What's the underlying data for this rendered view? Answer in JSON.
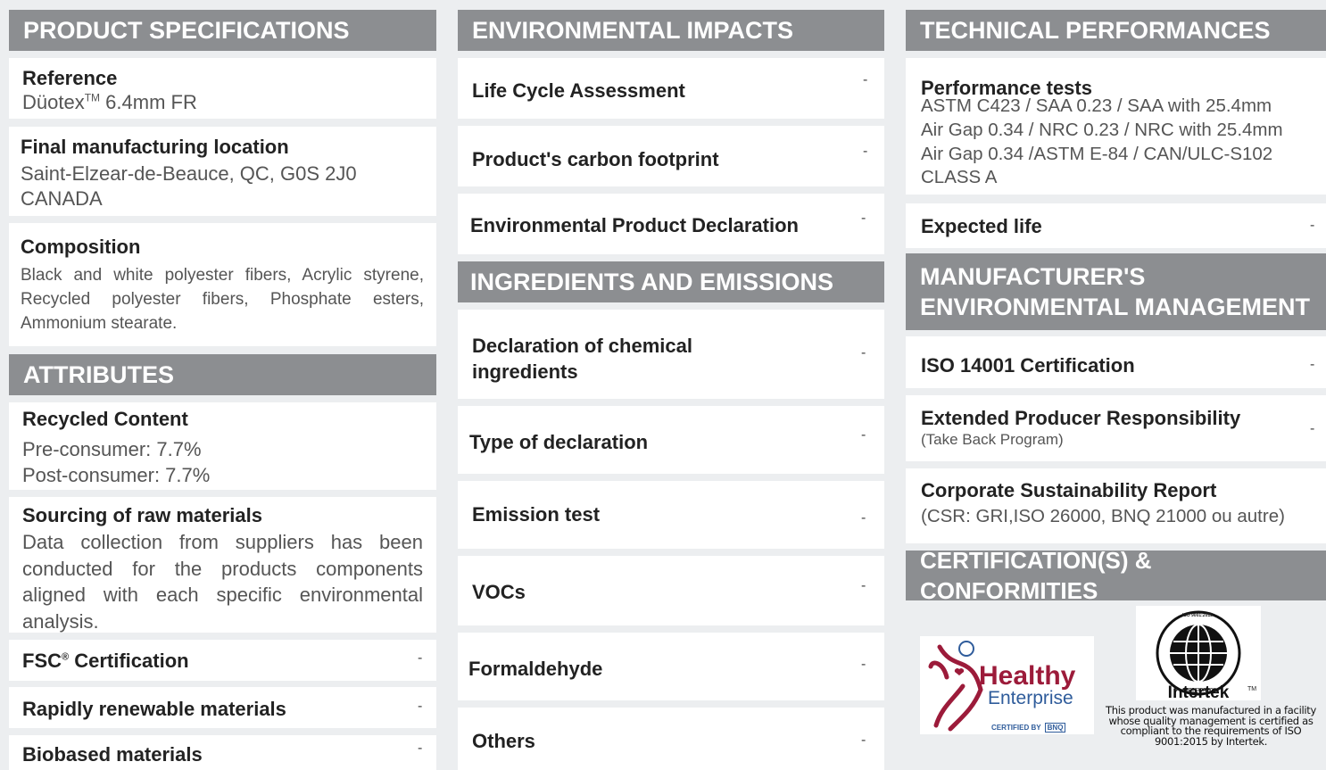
{
  "product_specifications": {
    "header": "PRODUCT SPECIFICATIONS",
    "reference_title": "Reference",
    "reference_value": "Düotex",
    "reference_tm": "TM",
    "reference_suffix": " 6.4mm FR",
    "location_title": "Final manufacturing location",
    "location_line1": "Saint-Elzear-de-Beauce, QC, G0S 2J0",
    "location_line2": "CANADA",
    "composition_title": "Composition",
    "composition_text": "Black and white polyester fibers, Acrylic styrene, Recycled polyester fibers, Phosphate esters, Ammonium stearate."
  },
  "attributes": {
    "header": "ATTRIBUTES",
    "recycled_title": "Recycled Content",
    "pre_consumer": "Pre-consumer: 7.7%",
    "post_consumer": "Post-consumer: 7.7%",
    "sourcing_title": "Sourcing of raw materials",
    "sourcing_text": "Data collection from suppliers has been conducted for the products components aligned with each specific environmental analysis.",
    "fsc_label": "FSC",
    "fsc_reg": "®",
    "fsc_suffix": " Certification",
    "fsc_value": "-",
    "rapidly_label": "Rapidly renewable materials",
    "rapidly_value": "-",
    "biobased_label": "Biobased materials",
    "biobased_value": "-"
  },
  "environmental_impacts": {
    "header": "ENVIRONMENTAL IMPACTS",
    "items": [
      {
        "label": "Life Cycle Assessment",
        "value": "-"
      },
      {
        "label": "Product's carbon footprint",
        "value": "-"
      },
      {
        "label": "Environmental Product Declaration",
        "value": "-"
      }
    ]
  },
  "ingredients": {
    "header": "INGREDIENTS AND EMISSIONS",
    "items": [
      {
        "label_line1": "Declaration of chemical",
        "label_line2": "ingredients",
        "value": "-"
      },
      {
        "label": "Type of declaration",
        "value": "-"
      },
      {
        "label": "Emission test",
        "value": "-"
      },
      {
        "label": "VOCs",
        "value": "-"
      },
      {
        "label": "Formaldehyde",
        "value": "-"
      },
      {
        "label": "Others",
        "value": "-"
      }
    ]
  },
  "technical": {
    "header": "TECHNICAL PERFORMANCES",
    "performance_title": "Performance tests",
    "performance_lines": [
      "ASTM C423 / SAA 0.23  / SAA with 25.4mm",
      "Air Gap 0.34 / NRC 0.23 /  NRC with 25.4mm",
      "Air Gap 0.34 /ASTM E-84 / CAN/ULC-S102",
      "CLASS A"
    ],
    "expected_life_label": "Expected life",
    "expected_life_value": "-"
  },
  "manufacturer": {
    "header_line1": "MANUFACTURER'S",
    "header_line2": "ENVIRONMENTAL MANAGEMENT",
    "iso_label": "ISO 14001 Certification",
    "iso_value": "-",
    "epr_label": "Extended Producer Responsibility",
    "epr_sub": "(Take Back Program)",
    "epr_value": "-",
    "csr_label": "Corporate Sustainability Report",
    "csr_sub": "(CSR: GRI,ISO 26000, BNQ 21000 ou autre)"
  },
  "certifications": {
    "header": "CERTIFICATION(S) & CONFORMITIES",
    "healthy_word": "Healthy",
    "enterprise_word": "Enterprise",
    "certified_by": "CERTIFIED BY",
    "bnq": "BNQ",
    "iso_seal_top": "ISO 9001:2015",
    "iso_seal_bottom": "CERTIFICATION",
    "tm": "TM",
    "intertek": "Intertek",
    "intertek_note": "This product was manufactured in a facility whose quality management is certified as compliant to the requirements of ISO 9001:2015 by Intertek.",
    "colors": {
      "healthy_red": "#9c1b3a",
      "healthy_blue": "#2f5c9b"
    }
  }
}
